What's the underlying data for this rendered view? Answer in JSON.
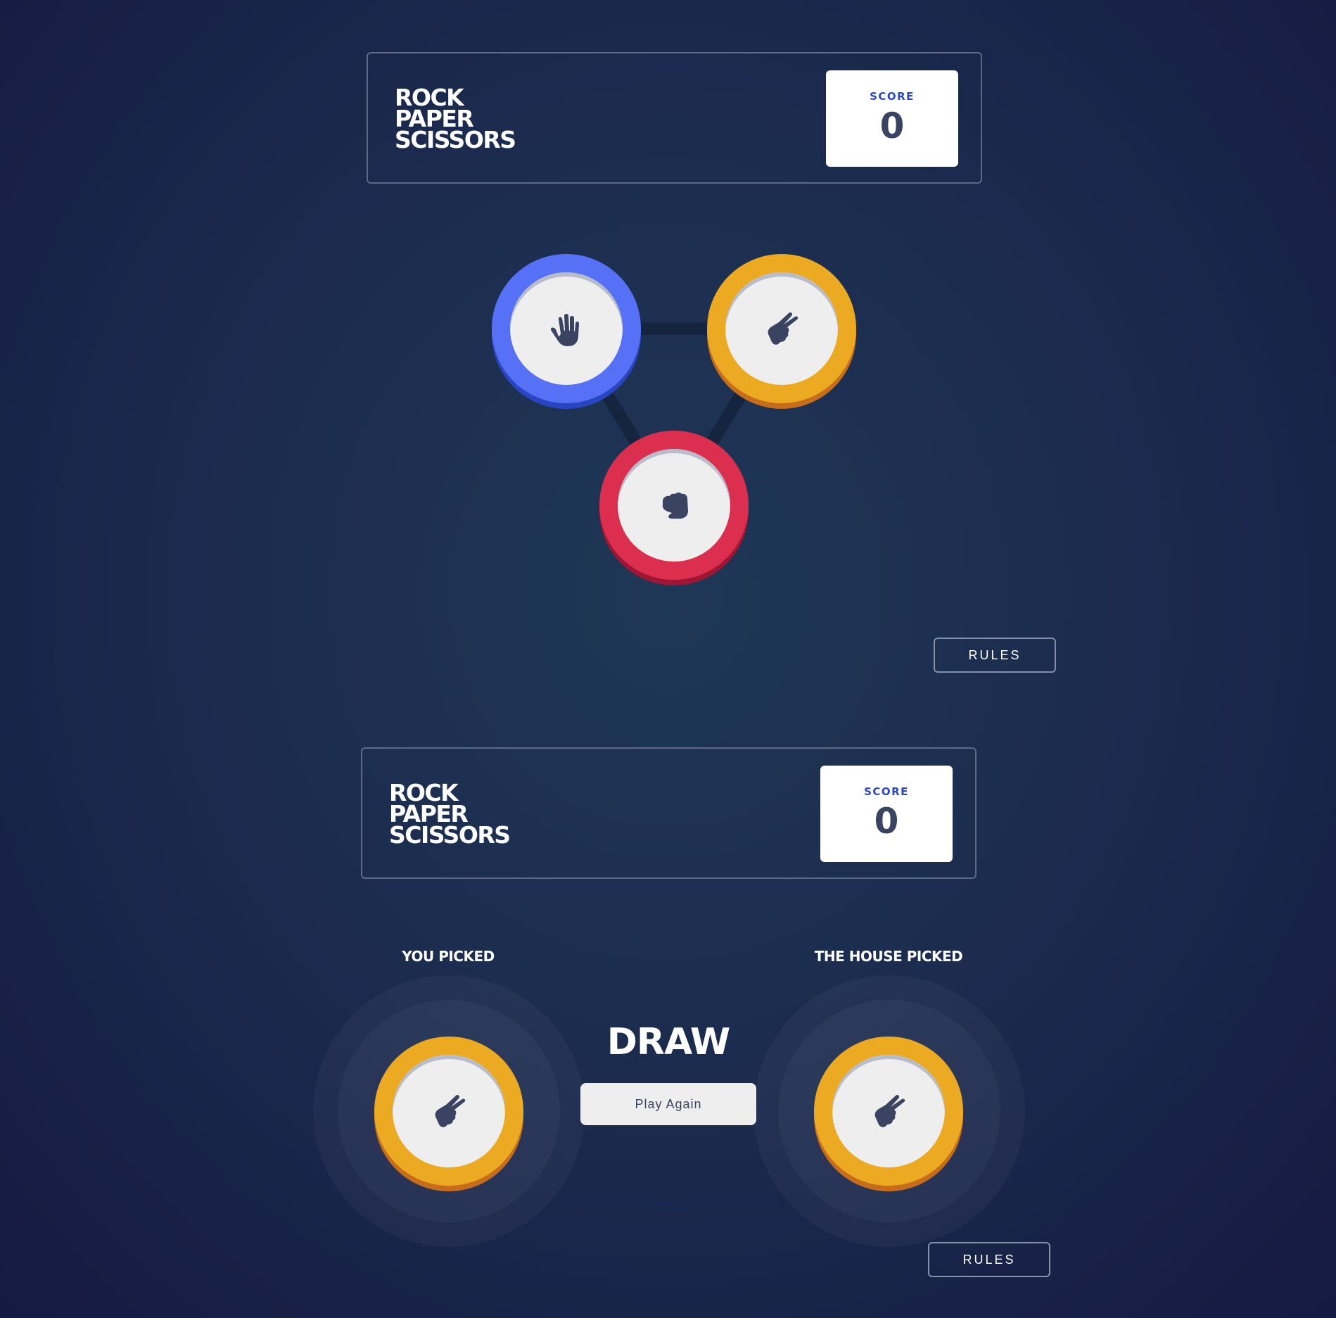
{
  "screen1": {
    "header": {
      "title_lines": [
        "ROCK",
        "PAPER",
        "SCISSORS"
      ],
      "score_label": "SCORE",
      "score_value": "0"
    },
    "choices": [
      {
        "name": "paper",
        "icon": "paper-hand-icon",
        "color": "#5671f5"
      },
      {
        "name": "scissors",
        "icon": "scissors-hand-icon",
        "color": "#eca922"
      },
      {
        "name": "rock",
        "icon": "rock-fist-icon",
        "color": "#dc2e4e"
      }
    ],
    "rules_label": "RULES"
  },
  "screen2": {
    "header": {
      "title_lines": [
        "ROCK",
        "PAPER",
        "SCISSORS"
      ],
      "score_label": "SCORE",
      "score_value": "0"
    },
    "you_picked_label": "YOU PICKED",
    "house_picked_label": "THE HOUSE PICKED",
    "you_choice": {
      "name": "scissors",
      "icon": "scissors-hand-icon",
      "color": "#eca922"
    },
    "house_choice": {
      "name": "scissors",
      "icon": "scissors-hand-icon",
      "color": "#eca922"
    },
    "result_text": "DRAW",
    "play_again_label": "Play Again",
    "rules_label": "RULES"
  }
}
